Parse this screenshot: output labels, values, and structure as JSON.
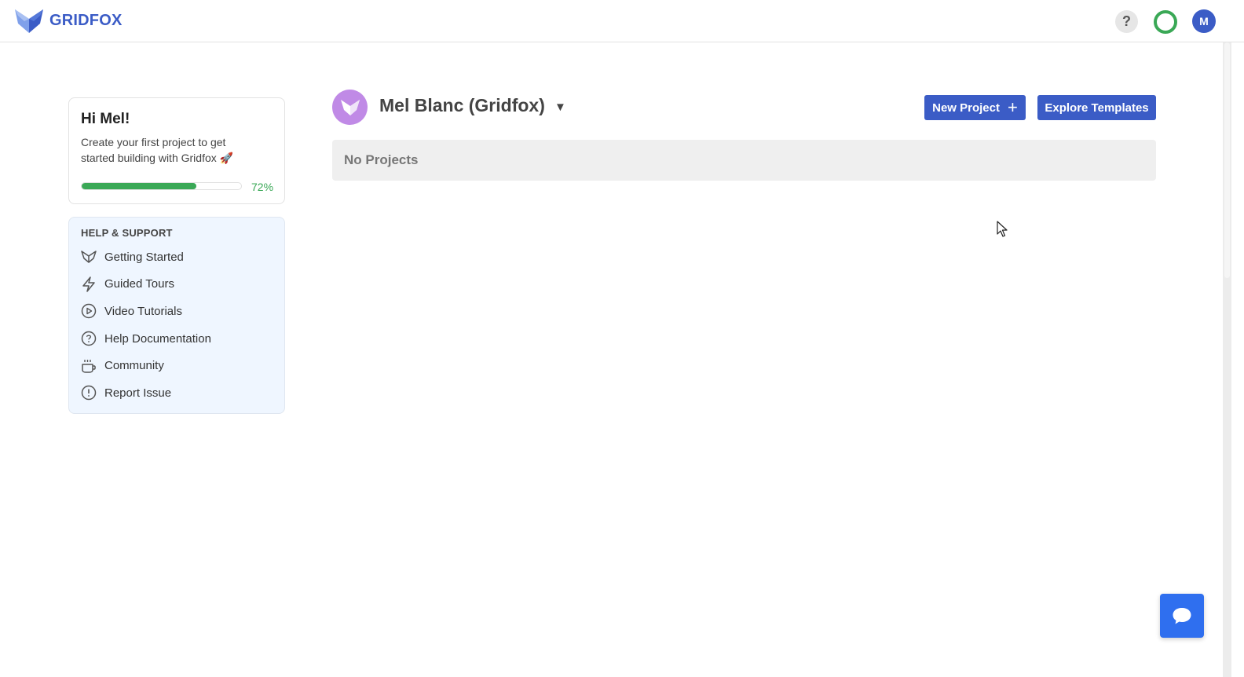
{
  "header": {
    "logo_text": "GRIDFOX",
    "help_label": "?",
    "avatar_initial": "M",
    "progress_ring_color": "#3aa856",
    "brand_color": "#3b5cc6"
  },
  "welcome": {
    "title": "Hi Mel!",
    "message": "Create your first project to get started building with Gridfox 🚀",
    "progress_fraction": 0.72,
    "progress_label": "72%"
  },
  "help_support": {
    "heading": "HELP & SUPPORT",
    "items": [
      {
        "label": "Getting Started",
        "icon": "fox-icon"
      },
      {
        "label": "Guided Tours",
        "icon": "lightning-icon"
      },
      {
        "label": "Video Tutorials",
        "icon": "play-circle-icon"
      },
      {
        "label": "Help Documentation",
        "icon": "question-circle-icon"
      },
      {
        "label": "Community",
        "icon": "coffee-cup-icon"
      },
      {
        "label": "Report Issue",
        "icon": "alert-circle-icon"
      }
    ]
  },
  "workspace": {
    "org_name": "Mel Blanc (Gridfox)",
    "new_project_label": "New Project",
    "explore_templates_label": "Explore Templates",
    "empty_state": "No Projects"
  }
}
